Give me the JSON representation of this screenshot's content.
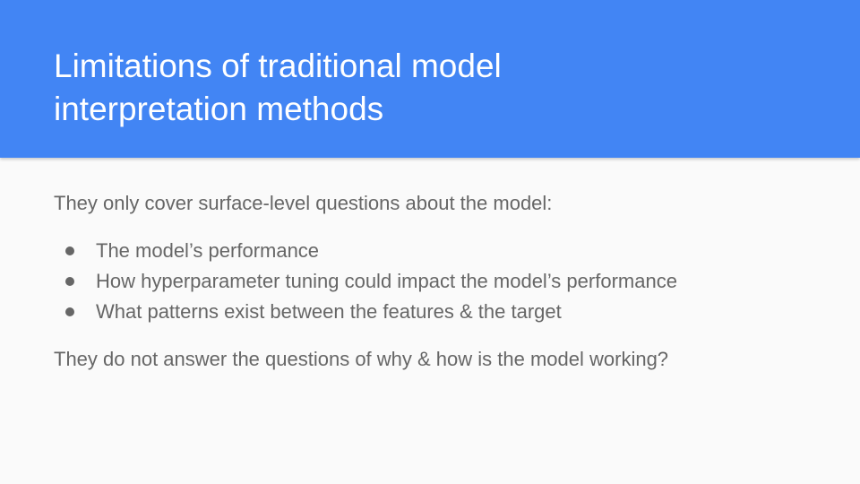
{
  "slide": {
    "title_line1": "Limitations of traditional model",
    "title_line2": "interpretation methods",
    "intro": "They only cover surface-level questions about the model:",
    "bullets": [
      "The model’s performance",
      "How hyperparameter tuning could impact the model’s performance",
      "What patterns exist between the features & the target"
    ],
    "outro": "They do not answer the questions of why & how is the model working?"
  },
  "colors": {
    "header_band": "#4285f4",
    "title_text": "#ffffff",
    "body_text": "#666666",
    "background": "#fafafa"
  }
}
